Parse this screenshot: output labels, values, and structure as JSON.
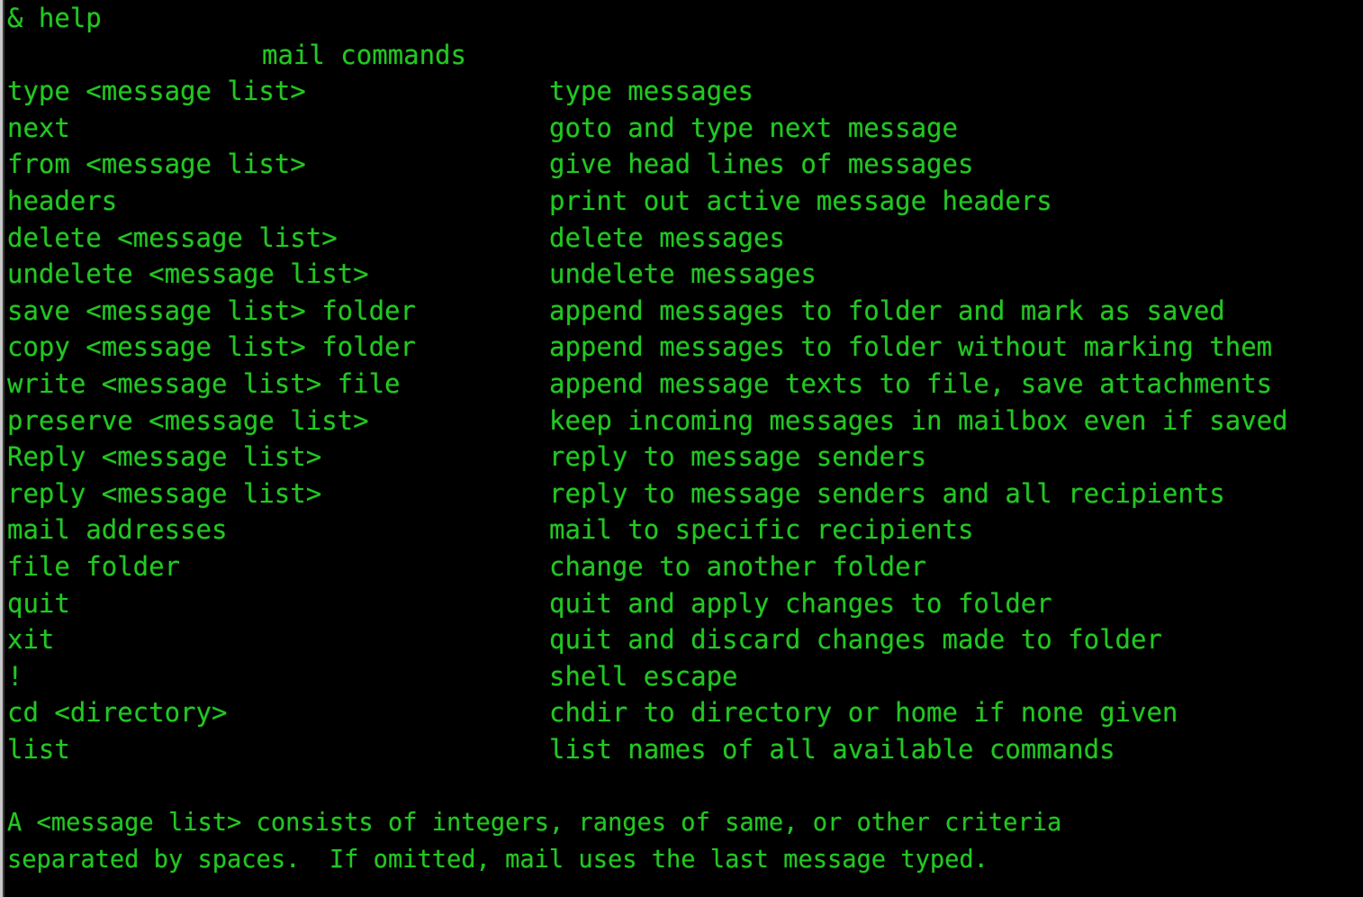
{
  "terminal": {
    "theme": {
      "background": "#000000",
      "foreground": "#23c723",
      "border": "#c9c9c9"
    },
    "prompt_line": "& help",
    "heading": "mail commands",
    "commands": [
      {
        "command": "type <message list>",
        "description": "type messages"
      },
      {
        "command": "next",
        "description": "goto and type next message"
      },
      {
        "command": "from <message list>",
        "description": "give head lines of messages"
      },
      {
        "command": "headers",
        "description": "print out active message headers"
      },
      {
        "command": "delete <message list>",
        "description": "delete messages"
      },
      {
        "command": "undelete <message list>",
        "description": "undelete messages"
      },
      {
        "command": "save <message list> folder",
        "description": "append messages to folder and mark as saved"
      },
      {
        "command": "copy <message list> folder",
        "description": "append messages to folder without marking them"
      },
      {
        "command": "write <message list> file",
        "description": "append message texts to file, save attachments"
      },
      {
        "command": "preserve <message list>",
        "description": "keep incoming messages in mailbox even if saved"
      },
      {
        "command": "Reply <message list>",
        "description": "reply to message senders"
      },
      {
        "command": "reply <message list>",
        "description": "reply to message senders and all recipients"
      },
      {
        "command": "mail addresses",
        "description": "mail to specific recipients"
      },
      {
        "command": "file folder",
        "description": "change to another folder"
      },
      {
        "command": "quit",
        "description": "quit and apply changes to folder"
      },
      {
        "command": "xit",
        "description": "quit and discard changes made to folder"
      },
      {
        "command": "!",
        "description": "shell escape"
      },
      {
        "command": "cd <directory>",
        "description": "chdir to directory or home if none given"
      },
      {
        "command": "list",
        "description": "list names of all available commands"
      }
    ],
    "footer": {
      "line1": "A <message list> consists of integers, ranges of same, or other criteria",
      "line2": "separated by spaces.  If omitted, mail uses the last message typed."
    }
  }
}
